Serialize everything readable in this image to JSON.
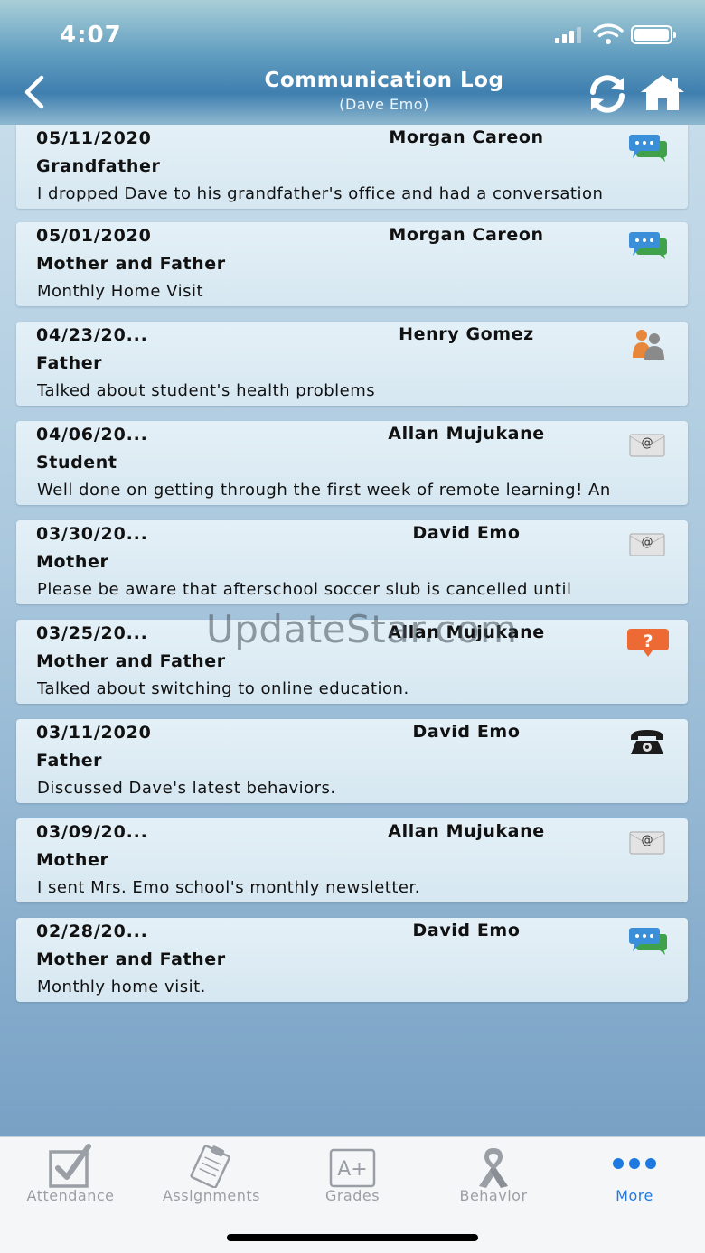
{
  "status_bar": {
    "time": "4:07"
  },
  "header": {
    "title": "Communication Log",
    "subtitle": "(Dave Emo)",
    "back_icon": "chevron-left-icon",
    "refresh_icon": "refresh-icon",
    "home_icon": "home-icon"
  },
  "entries": [
    {
      "date": "05/11/2020",
      "staff": "Morgan Careon",
      "contact": "Grandfather",
      "note": "I dropped Dave to his grandfather's office and had a conversation",
      "type_icon": "chat-bubbles-icon"
    },
    {
      "date": "05/01/2020",
      "staff": "Morgan Careon",
      "contact": "Mother and Father",
      "note": "Monthly Home Visit",
      "type_icon": "chat-bubbles-icon"
    },
    {
      "date": "04/23/20...",
      "staff": "Henry Gomez",
      "contact": "Father",
      "note": "Talked about student's health problems",
      "type_icon": "people-icon"
    },
    {
      "date": "04/06/20...",
      "staff": "Allan Mujukane",
      "contact": "Student",
      "note": "Well done on getting through the first week of remote learning! An",
      "type_icon": "email-icon"
    },
    {
      "date": "03/30/20...",
      "staff": "David Emo",
      "contact": "Mother",
      "note": "Please be aware that afterschool soccer slub is cancelled until",
      "type_icon": "email-icon"
    },
    {
      "date": "03/25/20...",
      "staff": "Allan Mujukane",
      "contact": "Mother and Father",
      "note": "Talked about switching to online education.",
      "type_icon": "question-bubble-icon"
    },
    {
      "date": "03/11/2020",
      "staff": "David Emo",
      "contact": "Father",
      "note": "Discussed Dave's latest behaviors.",
      "type_icon": "phone-icon"
    },
    {
      "date": "03/09/20...",
      "staff": "Allan Mujukane",
      "contact": "Mother",
      "note": "I sent Mrs. Emo school's monthly newsletter.",
      "type_icon": "email-icon"
    },
    {
      "date": "02/28/20...",
      "staff": "David Emo",
      "contact": "Mother and Father",
      "note": "Monthly home visit.",
      "type_icon": "chat-bubbles-icon"
    }
  ],
  "watermark": "UpdateStar.com",
  "tabbar": {
    "tabs": [
      {
        "label": "Attendance",
        "icon": "checkbox-icon"
      },
      {
        "label": "Assignments",
        "icon": "clipboard-icon"
      },
      {
        "label": "Grades",
        "icon": "grade-icon"
      },
      {
        "label": "Behavior",
        "icon": "ribbon-icon"
      },
      {
        "label": "More",
        "icon": "more-dots-icon",
        "active": true
      }
    ],
    "active_color": "#1f7ae0",
    "inactive_color": "#9a9fa5"
  }
}
